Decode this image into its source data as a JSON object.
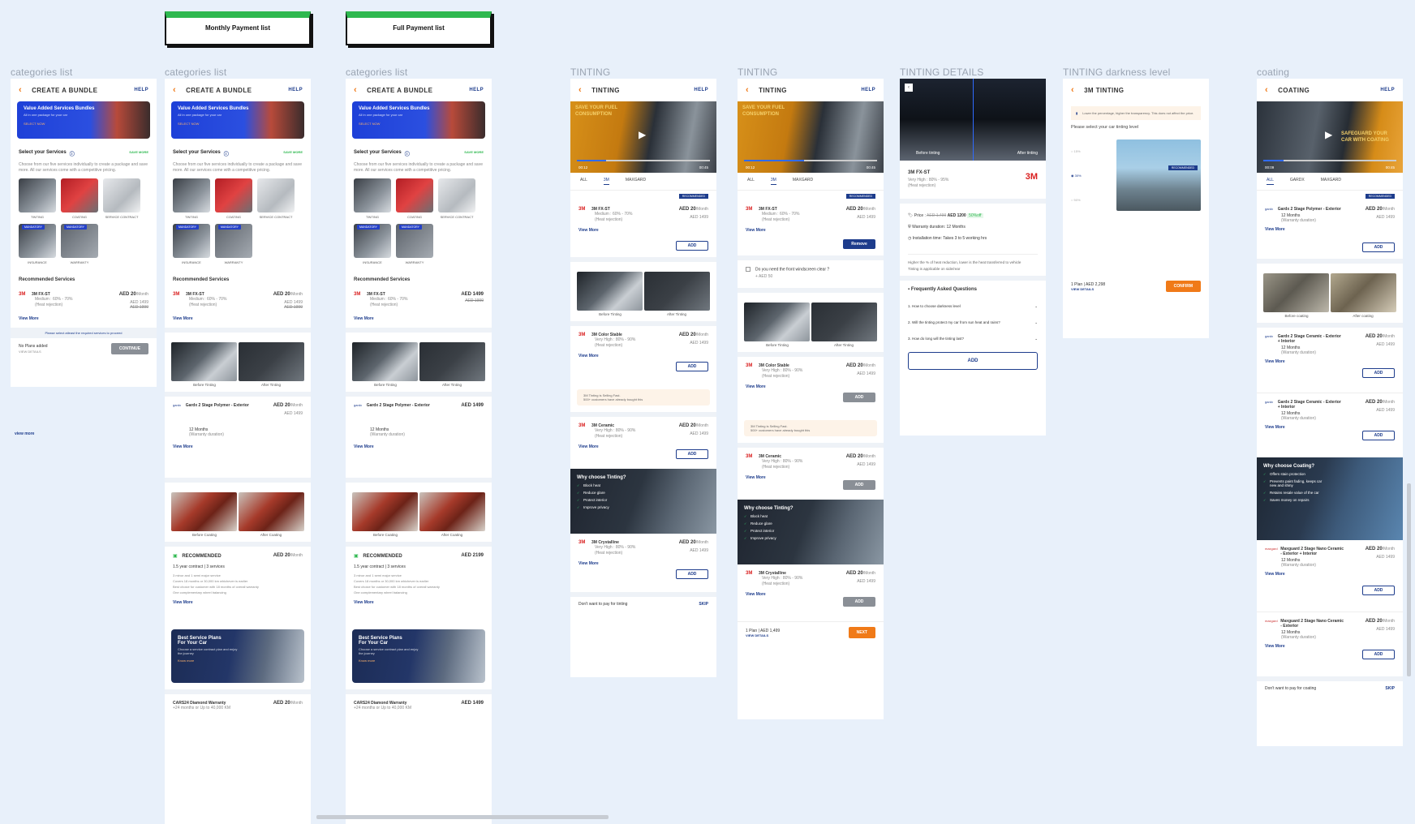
{
  "tags": {
    "monthly": "Monthly Payment  list",
    "full": "Full Payment  list"
  },
  "frame_labels": [
    "categories list",
    "categories list",
    "categories list",
    "TINTING",
    "TINTING",
    "TINTING DETAILS",
    "TINTING  darkness level",
    "coating"
  ],
  "common": {
    "create_bundle": "CREATE A BUNDLE",
    "help": "HELP",
    "banner_title": "Value Added Services Bundles",
    "banner_sub": "All in one package for your car",
    "banner_cta": "SELECT NOW",
    "select_services": "Select your Services",
    "save_more": "SAVE MORE",
    "select_desc": "Choose from our five services individually to create a package and save more. All our services come with a competitive pricing.",
    "tiles": [
      "TINTING",
      "COATING",
      "SERVICE CONTRACT",
      "INSURANCE",
      "WARRANTY"
    ],
    "mandatory": "MANDATORY",
    "recommended_services": "Recommended Services",
    "fxst": "3M FX-ST",
    "medium": "Medium : 60% - 70%",
    "heat_rejection": "(Heat rejection)",
    "aed20": "AED 20",
    "per_month": "/Month",
    "aed1499": "AED 1499",
    "aed1999": "AED 1999",
    "aed1499_bold": "AED 1499",
    "view_more": "View More",
    "please_select": "Please select atleast the required services to proceed",
    "no_plans": "No Plans added",
    "view_details": "VIEW DETAILS",
    "continue": "CONTINUE",
    "view_more_lower": "view more",
    "before_tinting": "Before Tinting",
    "after_tinting": "After Tinting",
    "gardx_polymer": "Gardx 2 Stage Polymer - Exterior",
    "twelve_months": "12 Months",
    "warranty_duration": "(Warranty duration)",
    "before_coating": "Before Coating",
    "after_coating": "After Coating",
    "recommended": "RECOMMENDED",
    "aed2199": "AED 2199",
    "contract": "1.5 year contract  |  3 services",
    "bullets": [
      "3 minor and 1 semi major service",
      "Covers 18 months or 30,000 km whichever is earlier",
      "Best choice for customer with 18 months of overall warranty",
      "One complementary wheel balancing"
    ],
    "best_plans_t1": "Best Service Plans",
    "best_plans_t2": "For Your Car",
    "best_plans_s": "Choose a service contract plan and enjoy the journey",
    "know_more": "Know more",
    "diamond": "CARS24 Diamond Warranty",
    "diamond_sub": "+24 months or Up to 40,000 KM"
  },
  "tinting": {
    "title": "TINTING",
    "video_text": "SAVE YOUR FUEL CONSUMPTION",
    "t_start": "00:12",
    "t_end": "00:45",
    "tabs": [
      "ALL",
      "3M",
      "MAXGARD"
    ],
    "recommended": "RECOMMENDED",
    "products": [
      "3M FX-ST",
      "3M Color Stable",
      "3M Ceramic",
      "3M Crystalline"
    ],
    "very_high": "Very High : 80% - 90%",
    "add": "ADD",
    "remove": "Remove",
    "hot_t": "3M Tinting is Selling Fast.",
    "hot_s": "500+ customers have already bought this",
    "why_title": "Why choose Tinting?",
    "why_items": [
      "Block heat",
      "Reduce glare",
      "Protect interior",
      "Improve privacy"
    ],
    "dont_want": "Don't want to pay for tinting",
    "skip": "SKIP",
    "windscreen": "Do you need the front windscreen clear ?",
    "windscreen_add": "+ AED 50",
    "plan_summary": "1 Plan  |  AED 1,499",
    "next": "NEXT",
    "view_details": "VIEW DETAILS"
  },
  "details": {
    "before": "Before tinting",
    "after": "After tinting",
    "product": "3M FX-ST",
    "vh": "Very High : 80% - 95%",
    "hr": "(Heat rejection)",
    "price_label": "Price : ",
    "old": "AED 1,499",
    "new": "AED 1200",
    "off": "50%off",
    "warranty": "Warranty duration: 12 Months",
    "install": "Installation time: Takes 3 to 5 working hrs",
    "note1": "Higher the % of heat reduction, lower is the heat transferred to vehicle",
    "note2": "Tinting is applicable on side/rear",
    "faq_title": "Frequently Asked Questions",
    "faqs": [
      "1. How to choose darkness level",
      "2. Will the tinting protect my car from sun heat and rains?",
      "3. How do long will the tinting last?"
    ],
    "add": "ADD"
  },
  "darkness": {
    "title": "3M TINTING",
    "info": "Lower the percentage, higher the transparency. This does not affect the price.",
    "prompt": "Please select your car tinting level",
    "levels": [
      "15%",
      "30%",
      "50%"
    ],
    "recommended": "RECOMMENDED",
    "plan": "1 Plan  |  AED 2,298",
    "view_details": "VIEW DETAILS",
    "confirm": "CONFIRM"
  },
  "coating": {
    "title": "COATING",
    "video_text": "SAFEGUARD YOUR CAR WITH COATING",
    "t_start": "00:09",
    "t_end": "00:45",
    "tabs": [
      "ALL",
      "GARDX",
      "MAXGARD"
    ],
    "products": [
      "Gardx 2 Stage Polymer - Exterior",
      "Gardx 2 Stage Ceramic - Exterior + Interior",
      "Gardx 2 Stage Ceramic - Exterior + Interior",
      "Maxguard 2 Stage Nano Ceramic - Exterior + Interior",
      "Maxguard 2 Stage Nano Ceramic - Exterior"
    ],
    "before": "Before coating",
    "after": "After coating",
    "why_title": "Why choose Coating?",
    "why_items": [
      "Offers stain protection",
      "Prevents paint fading, keeps car new and shiny",
      "Retains resale value of the car",
      "Saves money on repairs"
    ],
    "dont_want": "Don't want to pay for coating",
    "skip": "SKIP"
  }
}
